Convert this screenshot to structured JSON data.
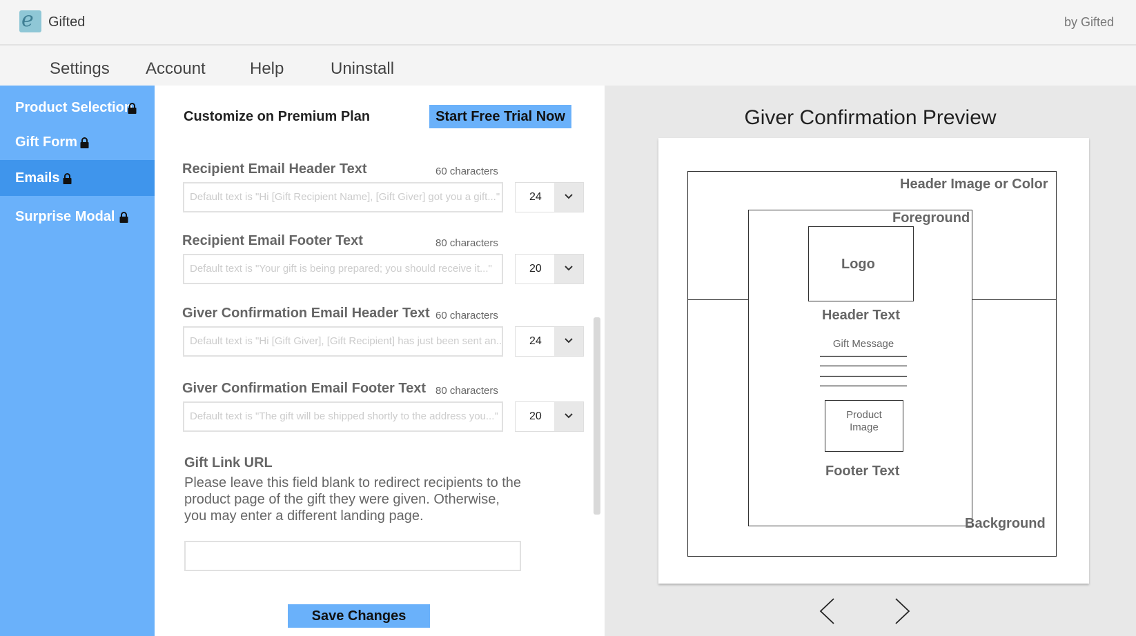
{
  "header": {
    "app_name": "Gifted",
    "by_line": "by Gifted",
    "logo_letter": "e"
  },
  "nav": {
    "items": [
      "Settings",
      "Account",
      "Help",
      "Uninstall"
    ]
  },
  "sidebar": {
    "items": [
      {
        "label": "Product Selection",
        "icon": "lock-icon"
      },
      {
        "label": "Gift Form",
        "icon": "lock-icon"
      },
      {
        "label": "Emails",
        "icon": "lock-icon",
        "active": true
      },
      {
        "label": "Surprise Modal",
        "icon": "lock-icon"
      }
    ],
    "colors": {
      "background": "#6ab1fa",
      "active": "#3f95ec"
    }
  },
  "main": {
    "premium_text": "Customize on Premium Plan",
    "trial_button": "Start Free Trial Now",
    "fields": [
      {
        "label": "Recipient Email Header Text",
        "chars": "60 characters",
        "placeholder": "Default text is \"Hi [Gift Recipient Name], [Gift Giver] got you a gift...\"",
        "size": "24"
      },
      {
        "label": "Recipient Email Footer Text",
        "chars": "80 characters",
        "placeholder": "Default text is \"Your gift is being prepared; you should receive it...\"",
        "size": "20"
      },
      {
        "label": "Giver Confirmation Email Header Text",
        "chars": "60 characters",
        "placeholder": "Default text is \"Hi [Gift Giver], [Gift Recipient] has just been sent an...\"",
        "size": "24"
      },
      {
        "label": "Giver Confirmation Email Footer Text",
        "chars": "80 characters",
        "placeholder": "Default text is \"The gift will be shipped shortly to the address you...\"",
        "size": "20"
      }
    ],
    "gift_link": {
      "title": "Gift Link URL",
      "description": "Please leave this field blank to redirect recipients to the product page of the gift they were given. Otherwise, you may enter a different landing page.",
      "value": ""
    },
    "save_button": "Save Changes"
  },
  "preview": {
    "title": "Giver Confirmation Preview",
    "labels": {
      "header_image": "Header Image or Color",
      "foreground": "Foreground",
      "logo": "Logo",
      "header_text": "Header Text",
      "gift_message": "Gift Message",
      "product_image": "Product Image",
      "footer_text": "Footer Text",
      "background": "Background"
    }
  }
}
